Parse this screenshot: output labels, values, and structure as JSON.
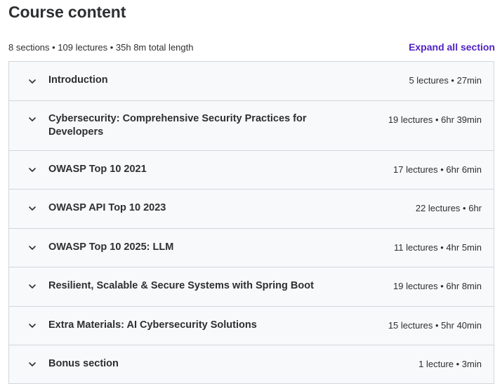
{
  "header": {
    "title": "Course content",
    "summary": "8 sections • 109 lectures • 35h 8m total length",
    "expand_all_label": "Expand all section"
  },
  "sections": [
    {
      "title": "Introduction",
      "meta": "5 lectures • 27min",
      "icon": "chevron-down-icon"
    },
    {
      "title": "Cybersecurity: Comprehensive Security Practices for Developers",
      "meta": "19 lectures • 6hr 39min",
      "icon": "chevron-down-icon"
    },
    {
      "title": "OWASP Top 10 2021",
      "meta": "17 lectures • 6hr 6min",
      "icon": "chevron-down-icon"
    },
    {
      "title": "OWASP API Top 10 2023",
      "meta": "22 lectures • 6hr",
      "icon": "chevron-down-icon"
    },
    {
      "title": "OWASP Top 10 2025: LLM",
      "meta": "11 lectures • 4hr 5min",
      "icon": "chevron-down-icon"
    },
    {
      "title": "Resilient, Scalable & Secure Systems with Spring Boot",
      "meta": "19 lectures • 6hr 8min",
      "icon": "chevron-down-icon"
    },
    {
      "title": "Extra Materials: AI Cybersecurity Solutions",
      "meta": "15 lectures • 5hr 40min",
      "icon": "chevron-down-icon"
    },
    {
      "title": "Bonus section",
      "meta": "1 lecture • 3min",
      "icon": "chevron-down-icon"
    }
  ],
  "colors": {
    "accent": "#5022c3",
    "text": "#2d2f31",
    "row_background": "#f7f9fa",
    "border": "#d1d7dc"
  }
}
